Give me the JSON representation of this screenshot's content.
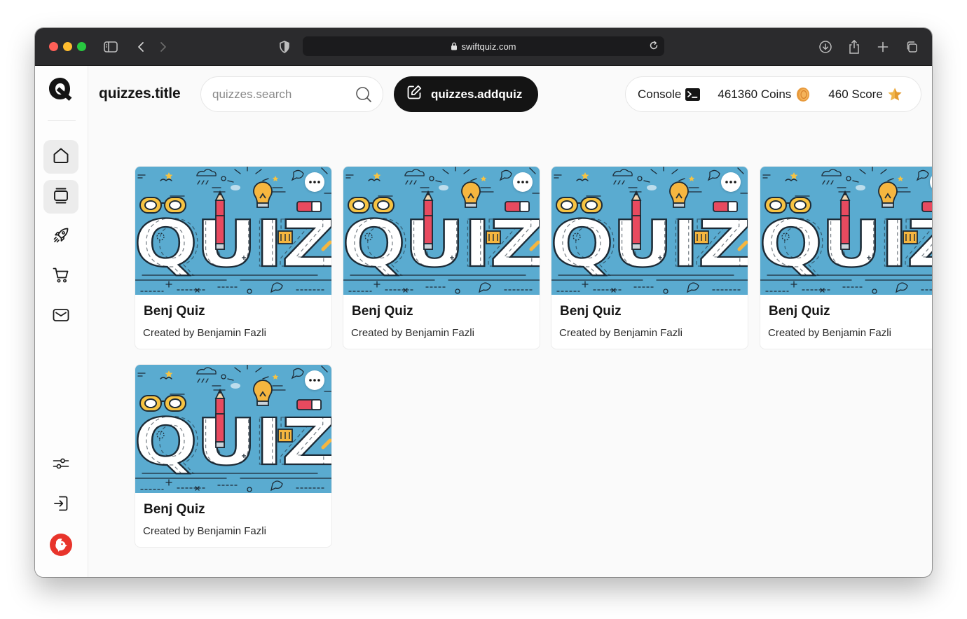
{
  "browser": {
    "url": "swiftquiz.com"
  },
  "header": {
    "title": "quizzes.title",
    "search_placeholder": "quizzes.search",
    "add_label": "quizzes.addquiz",
    "console_label": "Console",
    "coins_label": "461360 Coins",
    "score_label": "460 Score"
  },
  "sidebar": {
    "items": [
      {
        "icon": "home-icon",
        "active": true
      },
      {
        "icon": "quizzes-icon",
        "active": true
      },
      {
        "icon": "rocket-icon",
        "active": false
      },
      {
        "icon": "cart-icon",
        "active": false
      },
      {
        "icon": "mail-icon",
        "active": false
      }
    ],
    "bottom": [
      {
        "icon": "sliders-icon"
      },
      {
        "icon": "logout-icon"
      },
      {
        "icon": "avatar"
      }
    ]
  },
  "thumbnail_text": "QUIZ",
  "quizzes": [
    {
      "title": "Benj Quiz",
      "author": "Created by Benjamin Fazli"
    },
    {
      "title": "Benj Quiz",
      "author": "Created by Benjamin Fazli"
    },
    {
      "title": "Benj Quiz",
      "author": "Created by Benjamin Fazli"
    },
    {
      "title": "Benj Quiz",
      "author": "Created by Benjamin Fazli"
    },
    {
      "title": "Benj Quiz",
      "author": "Created by Benjamin Fazli"
    }
  ],
  "colors": {
    "accent": "#141414",
    "thumb_bg": "#5aabd0",
    "avatar": "#e8342b"
  }
}
